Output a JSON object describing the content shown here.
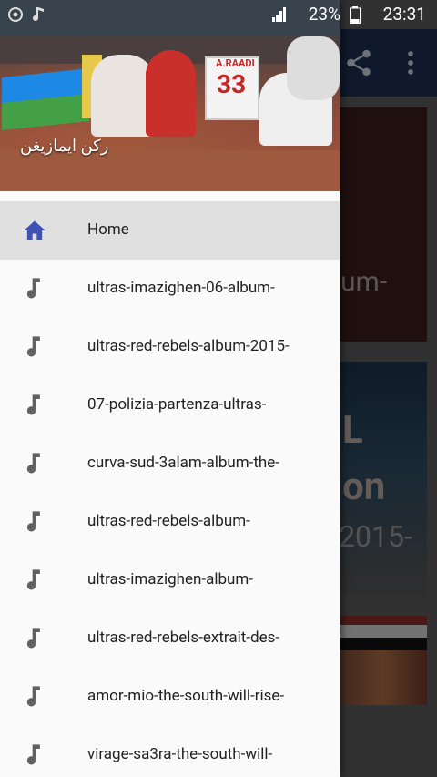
{
  "status_bar": {
    "battery_text": "23%",
    "time": "23:31",
    "icons": [
      "whatsapp-icon",
      "music-note-icon",
      "signal-icon",
      "battery-icon"
    ]
  },
  "drawer": {
    "header_title": "ركن ايمازيغن",
    "header_jersey_name": "A.RAADI",
    "header_jersey_number": "33",
    "items": [
      {
        "label": "Home",
        "icon": "home-icon",
        "active": true
      },
      {
        "label": "ultras-imazighen-06-album-",
        "icon": "music-note-icon"
      },
      {
        "label": "ultras-red-rebels-album-2015-",
        "icon": "music-note-icon"
      },
      {
        "label": "07-polizia-partenza-ultras-",
        "icon": "music-note-icon"
      },
      {
        "label": "curva-sud-3alam-album-the-",
        "icon": "music-note-icon"
      },
      {
        "label": "ultras-red-rebels-album-",
        "icon": "music-note-icon"
      },
      {
        "label": "ultras-imazighen-album-",
        "icon": "music-note-icon"
      },
      {
        "label": "ultras-red-rebels-extrait-des-",
        "icon": "music-note-icon"
      },
      {
        "label": "amor-mio-the-south-will-rise-",
        "icon": "music-note-icon"
      },
      {
        "label": "virage-sa3ra-the-south-will-",
        "icon": "music-note-icon"
      }
    ]
  },
  "background": {
    "card1_text": "um-",
    "card2_text_1": "L",
    "card2_text_2": "on",
    "card2_text_3": "2015-"
  },
  "colors": {
    "accent": "#3f51b5",
    "toolbar": "#1e2d50",
    "drawer_bg": "#fafafa",
    "active_item_bg": "#e0e0e0",
    "note_icon": "#616161"
  }
}
